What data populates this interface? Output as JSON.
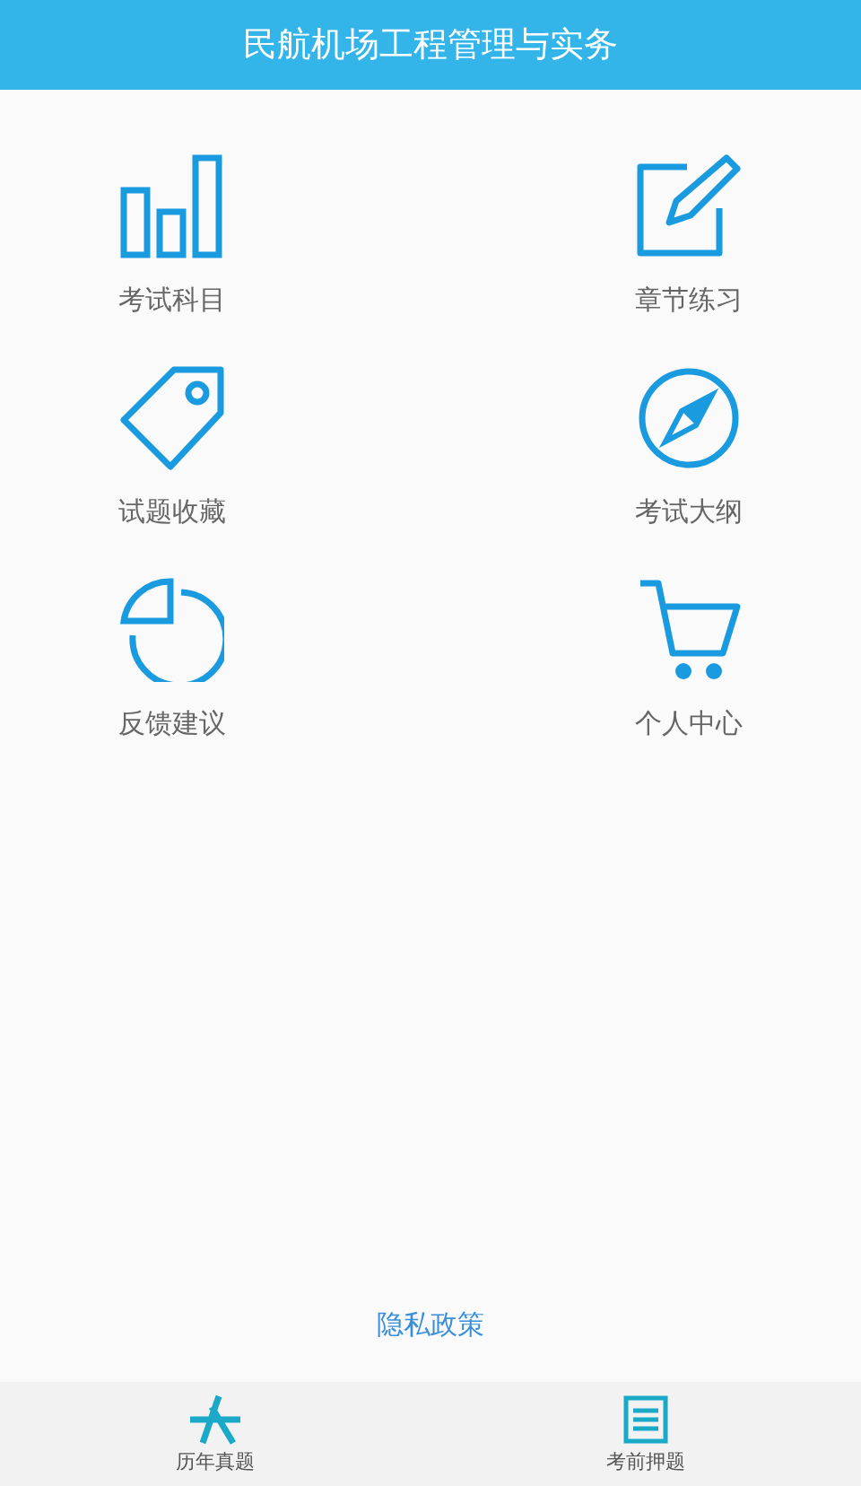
{
  "header": {
    "title": "民航机场工程管理与实务"
  },
  "menu": [
    {
      "kind": "chart",
      "label": "考试科目"
    },
    {
      "kind": "edit",
      "label": "章节练习"
    },
    {
      "kind": "tag",
      "label": "试题收藏"
    },
    {
      "kind": "compass",
      "label": "考试大纲"
    },
    {
      "kind": "pie",
      "label": "反馈建议"
    },
    {
      "kind": "cart",
      "label": "个人中心"
    }
  ],
  "privacy_link": "隐私政策",
  "bottom_tabs": [
    {
      "kind": "appstore",
      "label": "历年真题"
    },
    {
      "kind": "document",
      "label": "考前押题"
    }
  ]
}
